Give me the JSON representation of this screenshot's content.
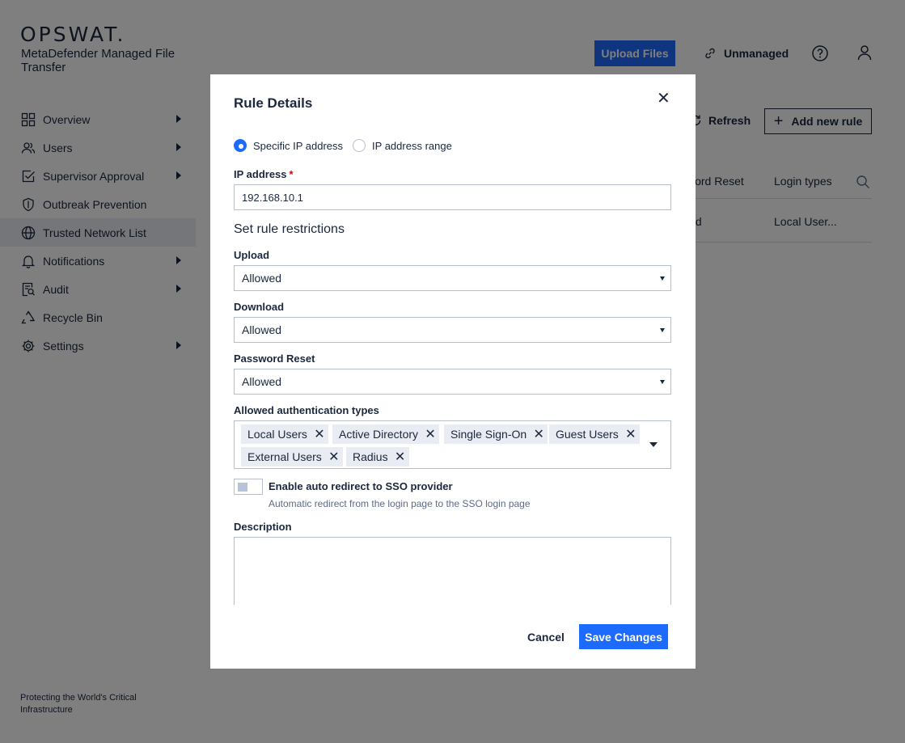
{
  "brand": {
    "logo_text": "OPSWAT.",
    "product_name": "MetaDefender Managed File Transfer",
    "footer": "Protecting the World's Critical Infrastructure"
  },
  "sidebar": {
    "items": [
      {
        "label": "Overview",
        "icon": "grid-icon",
        "has_submenu": true
      },
      {
        "label": "Users",
        "icon": "users-icon",
        "has_submenu": true
      },
      {
        "label": "Supervisor Approval",
        "icon": "checkbox-icon",
        "has_submenu": true
      },
      {
        "label": "Outbreak Prevention",
        "icon": "shield-icon",
        "has_submenu": false
      },
      {
        "label": "Trusted Network List",
        "icon": "globe-icon",
        "has_submenu": false,
        "active": true
      },
      {
        "label": "Notifications",
        "icon": "bell-icon",
        "has_submenu": true
      },
      {
        "label": "Audit",
        "icon": "audit-icon",
        "has_submenu": true
      },
      {
        "label": "Recycle Bin",
        "icon": "recycle-icon",
        "has_submenu": false
      },
      {
        "label": "Settings",
        "icon": "gear-icon",
        "has_submenu": true
      }
    ]
  },
  "header": {
    "upload_label": "Upload Files",
    "unmanaged_label": "Unmanaged"
  },
  "main": {
    "refresh_label": "Refresh",
    "add_rule_label": "Add new rule",
    "table": {
      "columns": [
        "sword Reset",
        "Login types"
      ],
      "rows": [
        [
          "wed",
          "Local User..."
        ]
      ]
    }
  },
  "modal": {
    "title": "Rule Details",
    "radio_specific": "Specific IP address",
    "radio_range": "IP address range",
    "selected_radio": "Specific IP address",
    "ip_label": "IP address",
    "ip_required_mark": "*",
    "ip_value": "192.168.10.1",
    "section_title": "Set rule restrictions",
    "upload_label": "Upload",
    "upload_value": "Allowed",
    "download_label": "Download",
    "download_value": "Allowed",
    "password_reset_label": "Password Reset",
    "password_reset_value": "Allowed",
    "auth_types_label": "Allowed authentication types",
    "auth_types": [
      "Local Users",
      "Active Directory",
      "Single Sign-On",
      "Guest Users",
      "External Users",
      "Radius"
    ],
    "toggle_label": "Enable auto redirect to SSO provider",
    "toggle_description": "Automatic redirect from the login page to the SSO login page",
    "toggle_on": false,
    "description_label": "Description",
    "description_value": "",
    "cancel_label": "Cancel",
    "save_label": "Save Changes"
  },
  "colors": {
    "accent": "#1d6bfc",
    "text": "#1b273c",
    "overlay": "rgba(0,0,0,0.5)"
  }
}
